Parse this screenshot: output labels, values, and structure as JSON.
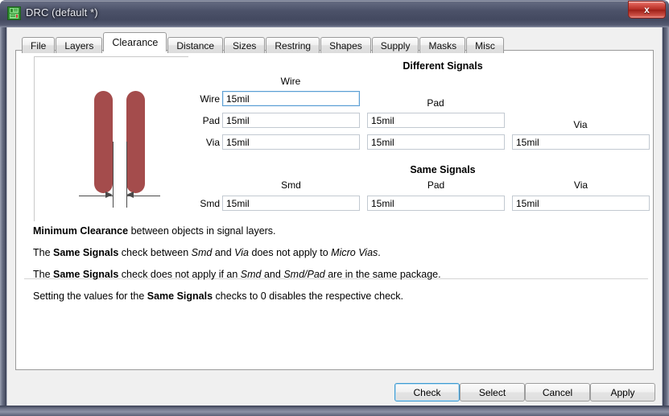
{
  "window": {
    "title": "DRC (default *)",
    "icon": "drc-save-icon",
    "close_label": "x",
    "titlebar_color": "#4a5068"
  },
  "tabs": [
    {
      "label": "File",
      "active": false
    },
    {
      "label": "Layers",
      "active": false
    },
    {
      "label": "Clearance",
      "active": true
    },
    {
      "label": "Distance",
      "active": false
    },
    {
      "label": "Sizes",
      "active": false
    },
    {
      "label": "Restring",
      "active": false
    },
    {
      "label": "Shapes",
      "active": false
    },
    {
      "label": "Supply",
      "active": false
    },
    {
      "label": "Masks",
      "active": false
    },
    {
      "label": "Misc",
      "active": false
    }
  ],
  "illustration": {
    "name": "clearance-diagram",
    "trace_color": "#a44c4c",
    "line_color": "#4a4a4a"
  },
  "different_signals": {
    "title": "Different Signals",
    "col_headers": [
      "Wire",
      "Pad",
      "Via"
    ],
    "row_labels": [
      "Wire",
      "Pad",
      "Via"
    ],
    "values": {
      "wire_wire": "15mil",
      "pad_wire": "15mil",
      "pad_pad": "15mil",
      "via_wire": "15mil",
      "via_pad": "15mil",
      "via_via": "15mil"
    },
    "focused_field": "wire_wire"
  },
  "same_signals": {
    "title": "Same Signals",
    "col_headers": [
      "Smd",
      "Pad",
      "Via"
    ],
    "row_labels": [
      "Smd"
    ],
    "values": {
      "smd_smd": "15mil",
      "smd_pad": "15mil",
      "smd_via": "15mil"
    }
  },
  "description": {
    "line1": {
      "b1": "Minimum Clearance",
      "t1": " between objects in signal layers."
    },
    "line2": {
      "t0": "The ",
      "b1": "Same Signals",
      "t1": " check between ",
      "i1": "Smd",
      "t2": " and ",
      "i2": "Via",
      "t3": " does not apply to ",
      "i3": "Micro Vias",
      "t4": "."
    },
    "line3": {
      "t0": "The ",
      "b1": "Same Signals",
      "t1": " check does not apply if an ",
      "i1": "Smd",
      "t2": " and ",
      "i2": "Smd/Pad",
      "t3": " are in the same package."
    },
    "line4": {
      "t0": "Setting the values for the ",
      "b1": "Same Signals",
      "t1": " checks to 0 disables the respective check."
    }
  },
  "buttons": [
    {
      "label": "Check",
      "default": true
    },
    {
      "label": "Select",
      "default": false
    },
    {
      "label": "Cancel",
      "default": false
    },
    {
      "label": "Apply",
      "default": false
    }
  ]
}
